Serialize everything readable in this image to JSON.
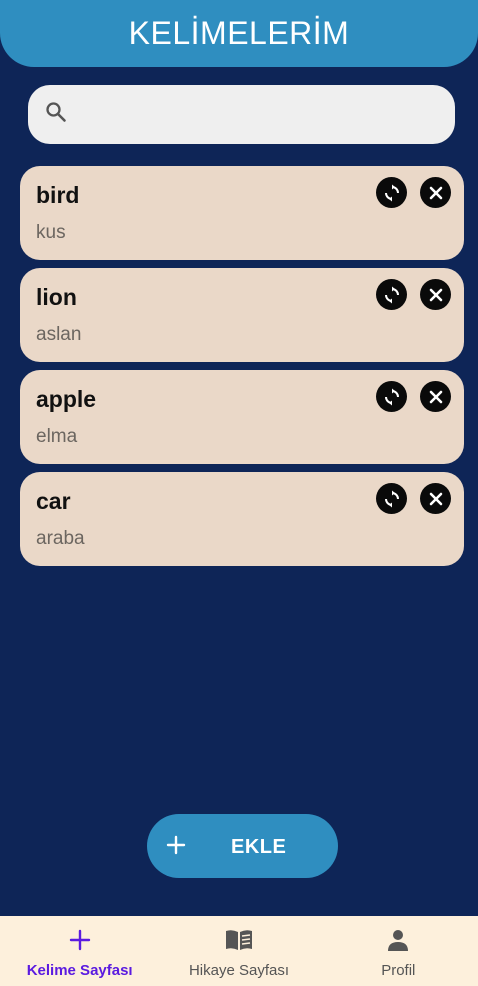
{
  "header": {
    "title": "KELİMELERİM"
  },
  "search": {
    "placeholder": "",
    "value": "",
    "icon": "search-icon"
  },
  "words": [
    {
      "word": "bird",
      "meaning": "kus"
    },
    {
      "word": "lion",
      "meaning": "aslan"
    },
    {
      "word": "apple",
      "meaning": "elma"
    },
    {
      "word": "car",
      "meaning": "araba"
    }
  ],
  "card_actions": {
    "sync_icon": "sync-icon",
    "delete_icon": "close-icon"
  },
  "add_button": {
    "label": "EKLE",
    "icon": "plus-icon"
  },
  "bottom_nav": {
    "items": [
      {
        "label": "Kelime Sayfası",
        "icon": "plus-icon",
        "active": true
      },
      {
        "label": "Hikaye Sayfası",
        "icon": "book-icon",
        "active": false
      },
      {
        "label": "Profil",
        "icon": "person-icon",
        "active": false
      }
    ]
  },
  "colors": {
    "background": "#0e2557",
    "header": "#2f8ec0",
    "card": "#ead8c8",
    "active_nav": "#5b1be0",
    "nav_background": "#fdf0dc"
  }
}
